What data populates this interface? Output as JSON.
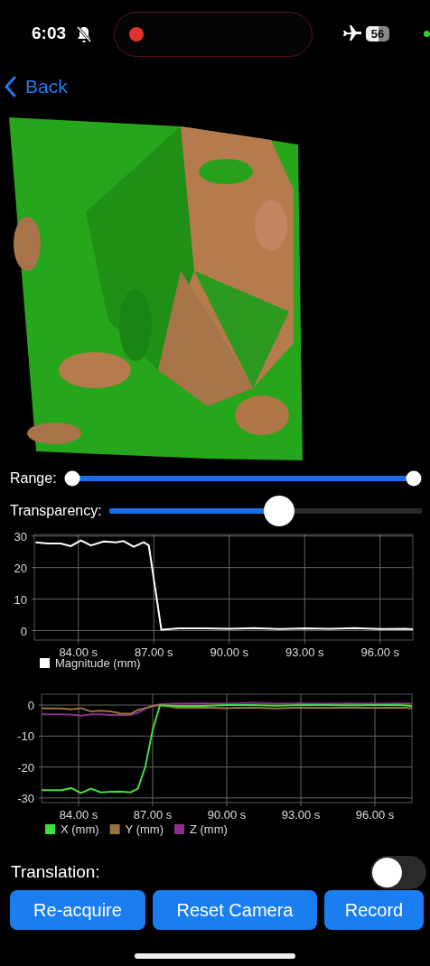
{
  "status_bar": {
    "time": "6:03",
    "recording": true,
    "battery": "56"
  },
  "nav": {
    "back": "Back"
  },
  "model_view": {
    "kind": "picture"
  },
  "range": {
    "label": "Range:",
    "thumbs": [
      {
        "level": 0
      },
      {
        "level": 1
      }
    ]
  },
  "transparency": {
    "label": "Transparency:",
    "level": 0.55
  },
  "charts": [
    {
      "chart_data": {
        "type": "line",
        "x": [
          82.3,
          82.8,
          83.3,
          83.7,
          84.1,
          84.5,
          85.0,
          85.5,
          85.8,
          86.2,
          86.6,
          86.8,
          87.3,
          88.0,
          89.0,
          90.0,
          91.0,
          92.0,
          93.0,
          94.0,
          95.0,
          96.0,
          97.0,
          97.3
        ],
        "series": [
          {
            "name": "Magnitude (mm)",
            "color": "#ffffff",
            "values": [
              28,
              27.6,
              27.6,
              26.8,
              28.6,
              27,
              28.3,
              28,
              28.4,
              26.6,
              28,
              27,
              0.3,
              0.7,
              0.7,
              0.6,
              0.8,
              0.5,
              0.7,
              0.6,
              0.8,
              0.5,
              0.6,
              0.4
            ]
          }
        ],
        "grid": true,
        "legend": "bottom-left",
        "xlim": [
          82.25,
          97.3
        ],
        "ylim": [
          -3,
          30.5
        ],
        "xticks": [
          {
            "value": 84,
            "label": "84.00 s"
          },
          {
            "value": 87,
            "label": "87.00 s"
          },
          {
            "value": 90,
            "label": "90.00 s"
          },
          {
            "value": 93,
            "label": "93.00 s"
          },
          {
            "value": 96,
            "label": "96.00 s"
          }
        ],
        "yticks": [
          0,
          10,
          20,
          30
        ]
      }
    },
    {
      "chart_data": {
        "type": "line",
        "x": [
          82.5,
          83.3,
          83.7,
          84.1,
          84.5,
          84.9,
          85.3,
          85.7,
          86.1,
          86.4,
          86.7,
          87.0,
          87.3,
          88.0,
          89.0,
          90.0,
          91.0,
          92.0,
          93.0,
          94.0,
          95.0,
          96.0,
          97.0,
          97.5
        ],
        "series": [
          {
            "name": "X (mm)",
            "color": "#3ee03a",
            "values": [
              -27.5,
              -27.5,
              -26.8,
              -28.4,
              -27,
              -28.2,
              -28,
              -27.9,
              -28.2,
              -27,
              -20,
              -8,
              0,
              -0.3,
              -0.3,
              0,
              0,
              -0.2,
              0,
              0,
              -0.1,
              0,
              0,
              -0.3
            ]
          },
          {
            "name": "Y (mm)",
            "color": "#9b7040",
            "values": [
              -1,
              -1.1,
              -1.4,
              -1,
              -2,
              -1.8,
              -2,
              -2.7,
              -2.8,
              -1.6,
              -1,
              -0.3,
              0,
              -0.9,
              -0.8,
              -1,
              -0.8,
              -1.1,
              -0.8,
              -0.9,
              -0.8,
              -0.9,
              -0.8,
              -1
            ]
          },
          {
            "name": "Z (mm)",
            "color": "#8a2f8a",
            "values": [
              -3,
              -3,
              -3.1,
              -3.4,
              -3,
              -3,
              -3.2,
              -3.2,
              -3.2,
              -2.5,
              -1.2,
              -0.3,
              0.3,
              0.5,
              0.6,
              0.5,
              0.7,
              0.5,
              0.6,
              0.5,
              0.6,
              0.5,
              0.6,
              0.5
            ]
          }
        ],
        "grid": true,
        "legend": "bottom-left",
        "xlim": [
          82.5,
          97.5
        ],
        "ylim": [
          -31.5,
          3.5
        ],
        "xticks": [
          {
            "value": 84,
            "label": "84.00 s"
          },
          {
            "value": 87,
            "label": "87.00 s"
          },
          {
            "value": 90,
            "label": "90.00 s"
          },
          {
            "value": 93,
            "label": "93.00 s"
          },
          {
            "value": 96,
            "label": "96.00 s"
          }
        ],
        "yticks": [
          0,
          -10,
          -20,
          -30
        ]
      }
    }
  ],
  "translation": {
    "label": "Translation:",
    "on": false
  },
  "buttons": [
    "Re-acquire",
    "Reset Camera",
    "Record"
  ]
}
